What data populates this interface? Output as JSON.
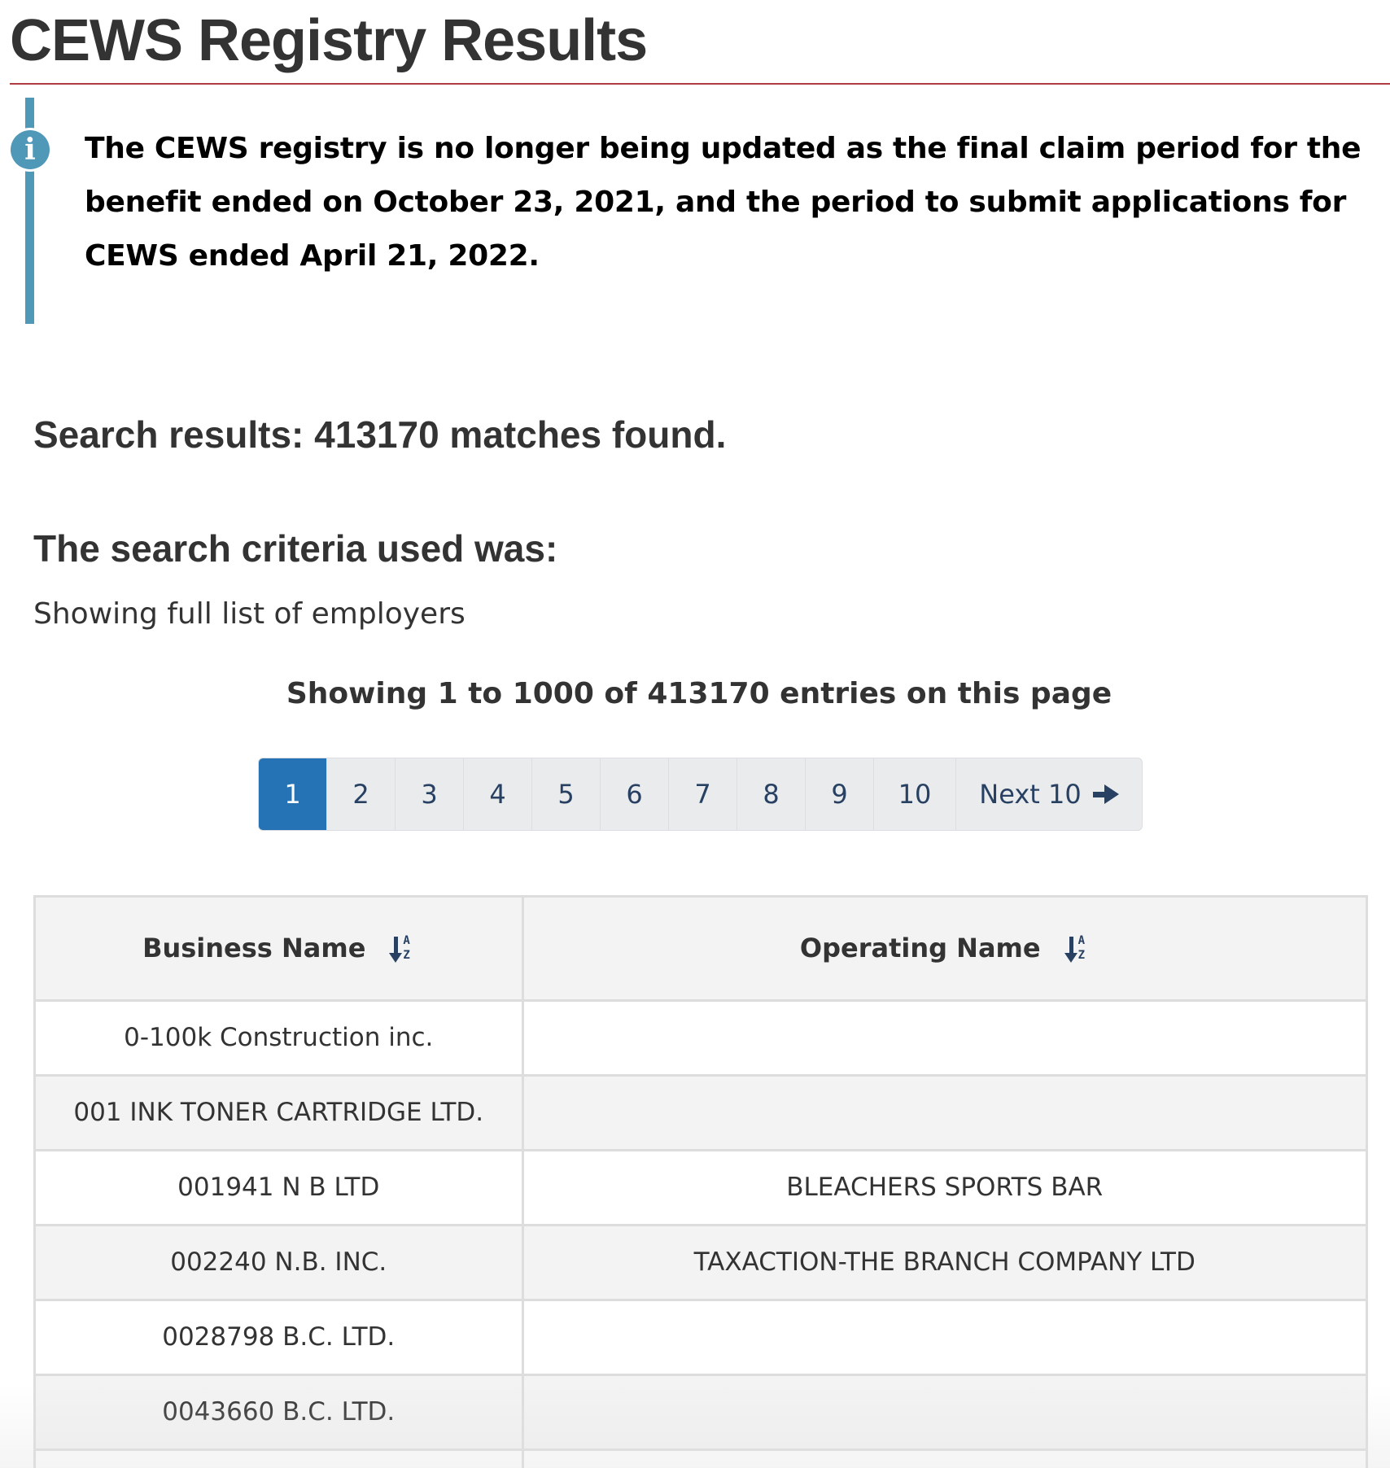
{
  "header": {
    "title": "CEWS Registry Results"
  },
  "alert": {
    "icon": "info-icon",
    "icon_glyph": "i",
    "message": "The CEWS registry is no longer being updated as the final claim period for the benefit ended on October 23, 2021, and the period to submit applications for CEWS ended April 21, 2022."
  },
  "results": {
    "heading": "Search results: 413170 matches found.",
    "criteria_heading": "The search criteria used was:",
    "criteria_text": "Showing full list of employers",
    "entries_text": "Showing 1 to 1000 of 413170 entries on this page"
  },
  "pagination": {
    "active_page": "1",
    "pages": [
      "1",
      "2",
      "3",
      "4",
      "5",
      "6",
      "7",
      "8",
      "9",
      "10"
    ],
    "next_label": "Next 10"
  },
  "table": {
    "columns": [
      {
        "label": "Business Name",
        "sort_icon": "sort-alpha-down-icon"
      },
      {
        "label": "Operating Name",
        "sort_icon": "sort-alpha-down-icon"
      }
    ],
    "rows": [
      {
        "business_name": "0-100k Construction inc.",
        "operating_name": ""
      },
      {
        "business_name": "001 INK TONER CARTRIDGE LTD.",
        "operating_name": ""
      },
      {
        "business_name": "001941 N B LTD",
        "operating_name": "BLEACHERS SPORTS BAR"
      },
      {
        "business_name": "002240 N.B. INC.",
        "operating_name": "TAXACTION-THE BRANCH COMPANY LTD"
      },
      {
        "business_name": "0028798 B.C. LTD.",
        "operating_name": ""
      },
      {
        "business_name": "0043660 B.C. LTD.",
        "operating_name": ""
      },
      {
        "business_name": "",
        "operating_name": ""
      }
    ]
  },
  "colors": {
    "title_rule": "#af3c43",
    "info_accent": "#4f98b8",
    "active_page": "#2572b4",
    "link_text": "#284162"
  }
}
